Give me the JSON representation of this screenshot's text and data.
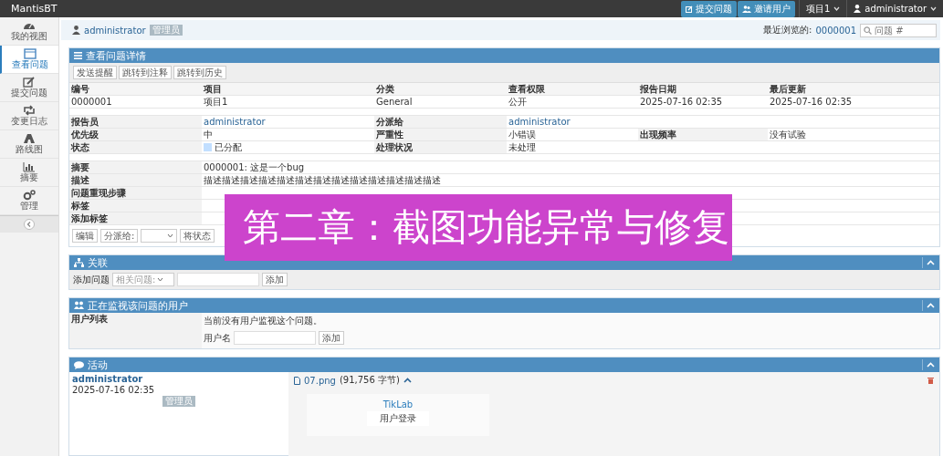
{
  "navbar": {
    "brand": "MantisBT",
    "buttons": [
      {
        "label": "提交问题",
        "kind": "edit"
      },
      {
        "label": "邀请用户",
        "kind": "users"
      }
    ],
    "project_menu": "项目1",
    "user_menu": "administrator"
  },
  "sidebar": {
    "items": [
      {
        "label": "我的视图",
        "selected": false
      },
      {
        "label": "查看问题",
        "selected": true
      },
      {
        "label": "提交问题",
        "selected": false
      },
      {
        "label": "变更日志",
        "selected": false
      },
      {
        "label": "路线图",
        "selected": false
      },
      {
        "label": "摘要",
        "selected": false
      },
      {
        "label": "管理",
        "selected": false
      }
    ]
  },
  "breadcrumb": {
    "user": "administrator",
    "role": "管理员",
    "recent_label": "最近浏览的:",
    "recent_link": "0000001",
    "search_placeholder": "问题 #"
  },
  "details": {
    "title": "查看问题详情",
    "actions": [
      "发送提醒",
      "跳转到注释",
      "跳转到历史"
    ],
    "columns": [
      "编号",
      "项目",
      "分类",
      "查看权限",
      "报告日期",
      "最后更新"
    ],
    "values": [
      "0000001",
      "项目1",
      "General",
      "公开",
      "2025-07-16 02:35",
      "2025-07-16 02:35"
    ],
    "info_rows": [
      [
        {
          "kind": "label",
          "text": "报告员"
        },
        {
          "kind": "link",
          "text": "administrator"
        },
        {
          "kind": "label",
          "text": "分派给"
        },
        {
          "kind": "link",
          "text": "administrator"
        },
        {
          "kind": "empty"
        }
      ],
      [
        {
          "kind": "label",
          "text": "优先级"
        },
        {
          "kind": "value",
          "text": "中"
        },
        {
          "kind": "label",
          "text": "严重性"
        },
        {
          "kind": "value",
          "text": "小错误"
        },
        {
          "kind": "label",
          "text": "出现频率"
        },
        {
          "kind": "value",
          "text": "没有试验"
        }
      ],
      [
        {
          "kind": "label",
          "text": "状态"
        },
        {
          "kind": "status",
          "text": "已分配",
          "color": "#c2dfff"
        },
        {
          "kind": "label",
          "text": "处理状况"
        },
        {
          "kind": "value",
          "text": "未处理"
        },
        {
          "kind": "empty"
        }
      ]
    ],
    "text_rows": [
      {
        "label": "摘要",
        "value": "0000001: 这是一个bug"
      },
      {
        "label": "描述",
        "value": "描述描述描述描述描述描述描述描述描述描述描述描述描述"
      },
      {
        "label": "问题重现步骤"
      },
      {
        "label": "标签"
      },
      {
        "label": "添加标签"
      }
    ],
    "footer": {
      "edit": "编辑",
      "assign": "分派给:",
      "status": "将状态"
    }
  },
  "banner": "第二章：截图功能异常与修复",
  "relations": {
    "title": "关联",
    "label": "添加问题",
    "select": "相关问题:",
    "button": "添加"
  },
  "monitors": {
    "title": "正在监视该问题的用户",
    "label": "用户列表",
    "message": "当前没有用户监视这个问题。",
    "field_label": "用户名",
    "button": "添加"
  },
  "activity": {
    "title": "活动",
    "user": "administrator",
    "time": "2025-07-16 02:35",
    "role": "管理员",
    "file": "07.png",
    "size": "(91,756 字节)",
    "preview": {
      "logo": "TikLab",
      "card": "用户登录"
    }
  }
}
